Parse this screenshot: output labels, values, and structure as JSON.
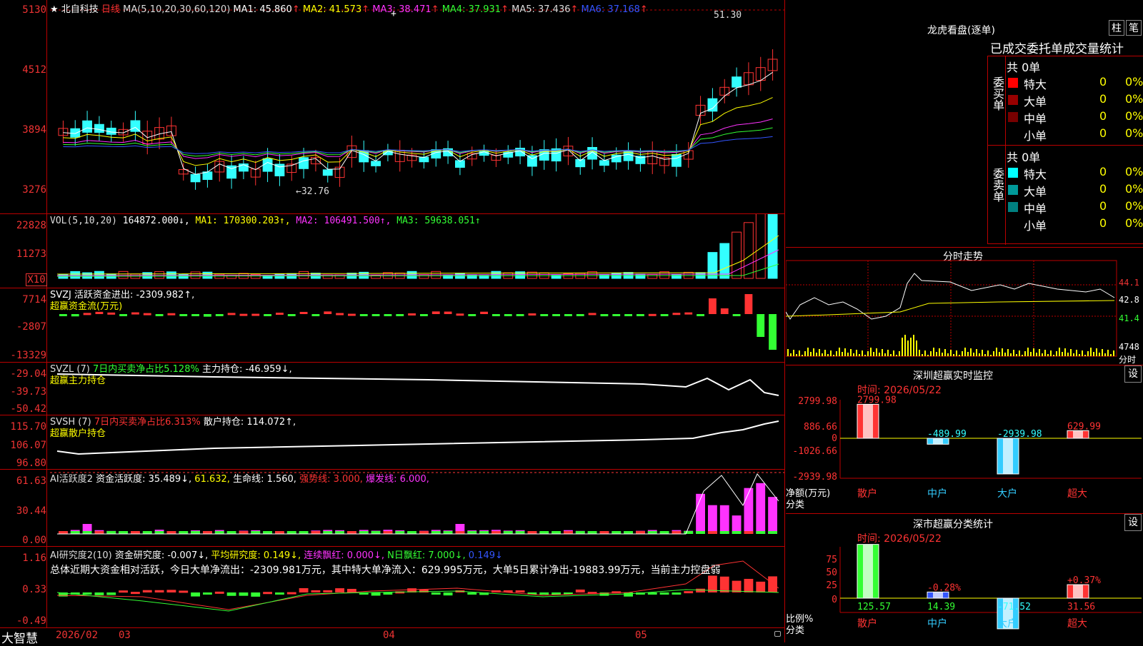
{
  "header": {
    "star": "★",
    "stock_name": "北自科技",
    "period": "日线",
    "ma_params": "MA(5,10,20,30,60,120)",
    "ma": [
      {
        "label": "MA1: 45.860",
        "color": "#ffffff",
        "arrow": "↑"
      },
      {
        "label": "MA2: 41.573",
        "color": "#ffff00",
        "arrow": "↑"
      },
      {
        "label": "MA3: 38.471",
        "color": "#ff33ff",
        "arrow": "↑"
      },
      {
        "label": "MA4: 37.931",
        "color": "#33ff33",
        "arrow": "↑"
      },
      {
        "label": "MA5: 37.436",
        "color": "#dddddd",
        "arrow": "↑"
      },
      {
        "label": "MA6: 37.168",
        "color": "#3355ff",
        "arrow": "↑"
      }
    ]
  },
  "price_pane": {
    "axis": [
      "5130",
      "4512",
      "3894",
      "3276"
    ],
    "high_label": "51.30",
    "low_label": "←32.76"
  },
  "vol_pane": {
    "axis": [
      "22828",
      "11273",
      "X10"
    ],
    "legend": [
      {
        "text": "VOL(5,10,20)",
        "color": "#dddddd"
      },
      {
        "text": " 164872.000↓,",
        "color": "#ffffff"
      },
      {
        "text": " MA1: 170300.203↑,",
        "color": "#ffff00"
      },
      {
        "text": " MA2: 106491.500↑,",
        "color": "#ff33ff"
      },
      {
        "text": " MA3: 59638.051↑",
        "color": "#33ff33"
      }
    ]
  },
  "svzj_pane": {
    "axis": [
      "7714",
      "-2807",
      "-13329"
    ],
    "line1": "SVZJ  活跃资金进出: -2309.982↑,",
    "line2": "超赢资金流(万元)"
  },
  "svzl_pane": {
    "axis": [
      "-29.04",
      "-39.73",
      "-50.42"
    ],
    "prefix": "SVZL (7)",
    "green_text": " 7日内买卖净占比5.128%",
    "white_text": " 主力持仓: -46.959↓,",
    "line2": "超赢主力持仓"
  },
  "svsh_pane": {
    "axis": [
      "115.70",
      "106.07",
      "96.80"
    ],
    "prefix": "SVSH (7)",
    "red_text": " 7日内买卖净占比6.313%",
    "white_text": " 散户持仓: 114.072↑,",
    "line2": "超赢散户持仓"
  },
  "ai_pane": {
    "axis": [
      "61.63",
      "30.44",
      "0.00"
    ],
    "legend": [
      {
        "text": "AI活跃度2",
        "color": "#dddddd"
      },
      {
        "text": " 资金活跃度: 35.489↓,",
        "color": "#ffffff"
      },
      {
        "text": " 61.632,",
        "color": "#ffff00"
      },
      {
        "text": " 生命线: 1.560,",
        "color": "#ffffff"
      },
      {
        "text": " 强势线: 3.000,",
        "color": "#ff3333"
      },
      {
        "text": " 爆发线: 6.000,",
        "color": "#ff33ff"
      }
    ]
  },
  "research_pane": {
    "axis": [
      "1.16",
      "0.33",
      "-0.49"
    ],
    "legend": [
      {
        "text": "AI研究度2(10)",
        "color": "#dddddd"
      },
      {
        "text": " 资金研究度: -0.007↓,",
        "color": "#ffffff"
      },
      {
        "text": " 平均研究度: 0.149↓,",
        "color": "#ffff00"
      },
      {
        "text": " 连续飘红: 0.000↓,",
        "color": "#ff33ff"
      },
      {
        "text": " N日飘红: 7.000↓,",
        "color": "#33ff33"
      },
      {
        "text": " 0.149↓",
        "color": "#3355ff"
      }
    ],
    "summary": "总体近期大资金相对活跃，今日大单净流出：-2309.981万元，其中特大单净流入：629.995万元，大单5日累计净出-19883.99万元，当前主力控盘弱"
  },
  "footer": {
    "logo": "大智慧",
    "dates": [
      "2026/02",
      "03",
      "04",
      "05"
    ]
  },
  "dragon_panel": {
    "title": "龙虎看盘(逐单)",
    "btn1": "柱",
    "btn2": "笔",
    "subtitle": "已成交委托单成交量统计",
    "buy": {
      "side": "委买单",
      "total": "共 0单",
      "rows": [
        {
          "label": "特大",
          "value": "0",
          "pct": "0%",
          "color": "#ff0000"
        },
        {
          "label": "大单",
          "value": "0",
          "pct": "0%",
          "color": "#990000"
        },
        {
          "label": "中单",
          "value": "0",
          "pct": "0%",
          "color": "#770000"
        },
        {
          "label": "小单",
          "value": "0",
          "pct": "0%",
          "color": "#000000"
        }
      ]
    },
    "sell": {
      "side": "委卖单",
      "total": "共 0单",
      "rows": [
        {
          "label": "特大",
          "value": "0",
          "pct": "0%",
          "color": "#00ffff"
        },
        {
          "label": "大单",
          "value": "0",
          "pct": "0%",
          "color": "#009999"
        },
        {
          "label": "中单",
          "value": "0",
          "pct": "0%",
          "color": "#008080"
        },
        {
          "label": "小单",
          "value": "0",
          "pct": "0%",
          "color": "#000000"
        }
      ]
    }
  },
  "intraday": {
    "title": "分时走势",
    "axis": [
      "44.1",
      "42.8",
      "41.4",
      "4748",
      "分时"
    ]
  },
  "sz_monitor": {
    "title": "深圳超赢实时监控",
    "btn": "设",
    "time": "时间: 2026/05/22",
    "axis": [
      "2799.98",
      "886.66",
      "0",
      "-1026.66",
      "-2939.98"
    ],
    "ylabel1": "净额(万元)",
    "ylabel2": "分类",
    "bars": [
      {
        "name": "散户",
        "value": 2799.98,
        "label": "2799.98",
        "color": "#ff3333"
      },
      {
        "name": "中户",
        "value": -489.99,
        "label": "-489.99",
        "color": "#33ccff"
      },
      {
        "name": "大户",
        "value": -2939.98,
        "label": "-2939.98",
        "color": "#33ccff"
      },
      {
        "name": "超大",
        "value": 629.99,
        "label": "629.99",
        "color": "#ff3333"
      }
    ]
  },
  "sz_class": {
    "title": "深市超赢分类统计",
    "btn": "设",
    "time": "时间: 2026/05/22",
    "axis": [
      "75",
      "50",
      "25",
      "0"
    ],
    "ylabel1": "比例%",
    "ylabel2": "分类",
    "bars": [
      {
        "name": "散户",
        "value": 125.57,
        "label": "125.57",
        "top": "",
        "color": "#33ff33"
      },
      {
        "name": "中户",
        "value": 14.39,
        "label": "14.39",
        "top": "-0.28%",
        "color": "#3355ff"
      },
      {
        "name": "大户",
        "value": -71.52,
        "label": "-71.52",
        "top": "",
        "color": "#33ccff"
      },
      {
        "name": "超大",
        "value": 31.56,
        "label": "31.56",
        "top": "+0.37%",
        "color": "#ff3333"
      }
    ]
  }
}
